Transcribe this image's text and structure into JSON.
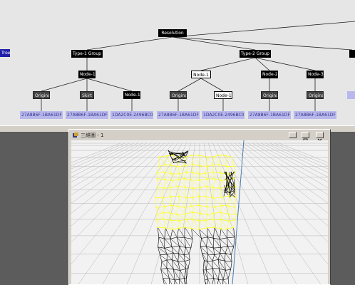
{
  "tree": {
    "root": {
      "label": "Resolution"
    },
    "left_stub": {
      "label": "Tree"
    },
    "groups": [
      {
        "label": "Type-1 Group"
      },
      {
        "label": "Type-2 Group"
      }
    ],
    "nodes": [
      {
        "label": "Node-1"
      },
      {
        "label": "Node-1"
      },
      {
        "label": "Node-2"
      },
      {
        "label": "Node-3"
      }
    ],
    "leaves": [
      {
        "label": "Original"
      },
      {
        "label": "Skirt"
      },
      {
        "label": "Node-1"
      },
      {
        "label": "Original"
      },
      {
        "label": "Node-1"
      },
      {
        "label": "Original"
      },
      {
        "label": "Original"
      }
    ],
    "guids": [
      {
        "label": "27A8B6F-1BA61DF"
      },
      {
        "label": "27A8B6F-1BA61DF"
      },
      {
        "label": "1DA2C0E-2496BC0"
      },
      {
        "label": "27A8B6F-1BA61DF"
      },
      {
        "label": "1DA2C0E-2496BC0"
      },
      {
        "label": "27A8B6F-1BA61DF"
      },
      {
        "label": "27A8B6F-1BA61DF"
      }
    ]
  },
  "viewer": {
    "window_title": "三維圖 - 1",
    "icon": "app-icon",
    "buttons": [
      "minimize-icon",
      "maximize-icon",
      "close-icon"
    ],
    "colors": {
      "highlight_mesh": "#ffff30",
      "mesh": "#000000",
      "floor_grid": "#b4b4b4"
    }
  }
}
